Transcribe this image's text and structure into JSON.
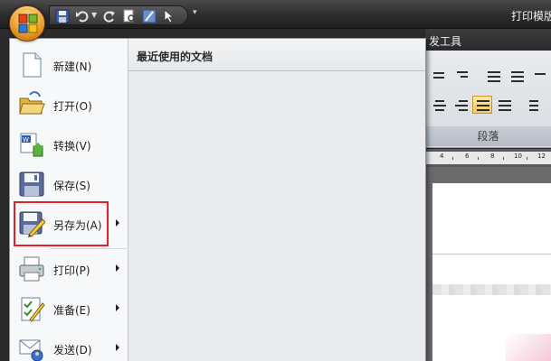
{
  "window": {
    "title": "打印模版"
  },
  "quick_access": {
    "items": [
      "save-icon",
      "undo-icon",
      "redo-icon",
      "print-preview-icon",
      "draw-icon",
      "pointer-icon"
    ]
  },
  "ribbon": {
    "tab_label": "发工具",
    "group_label": "段落",
    "ruler_numbers": [
      "4",
      "6",
      "8",
      "10",
      "12"
    ]
  },
  "office_menu": {
    "items": [
      {
        "label": "新建(N)",
        "icon": "new-document-icon",
        "submenu": false
      },
      {
        "label": "打开(O)",
        "icon": "open-folder-icon",
        "submenu": false
      },
      {
        "label": "转换(V)",
        "icon": "convert-icon",
        "submenu": false
      },
      {
        "label": "保存(S)",
        "icon": "save-icon",
        "submenu": false
      },
      {
        "label": "另存为(A)",
        "icon": "save-as-icon",
        "submenu": true
      },
      {
        "label": "打印(P)",
        "icon": "printer-icon",
        "submenu": true
      },
      {
        "label": "准备(E)",
        "icon": "prepare-icon",
        "submenu": true
      },
      {
        "label": "发送(D)",
        "icon": "send-icon",
        "submenu": true
      }
    ],
    "recent_title": "最近使用的文档"
  },
  "colors": {
    "highlight": "#e0202a",
    "menu_bg": "#f5f6f7",
    "title_bar": "#2c2c2c"
  }
}
